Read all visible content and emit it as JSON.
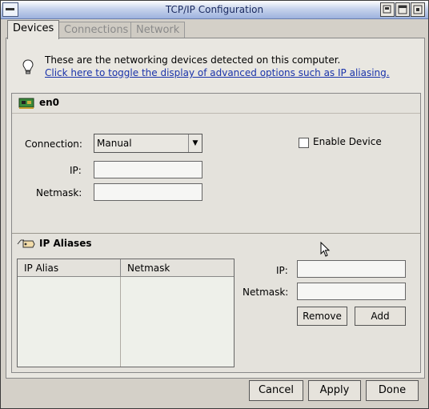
{
  "window": {
    "title": "TCP/IP Configuration",
    "tabs": [
      {
        "label": "Devices"
      },
      {
        "label": "Connections"
      },
      {
        "label": "Network"
      }
    ]
  },
  "info": {
    "text": "These are the networking devices detected on this computer.",
    "link": "Click here to toggle the display of advanced options such as IP aliasing."
  },
  "device": {
    "name": "en0",
    "connection_label": "Connection:",
    "connection_value": "Manual",
    "ip_label": "IP:",
    "ip_value": "",
    "netmask_label": "Netmask:",
    "netmask_value": "",
    "enable_label": "Enable Device",
    "enabled": false
  },
  "aliases": {
    "header": "IP Aliases",
    "columns": [
      "IP Alias",
      "Netmask"
    ],
    "rows": [],
    "ip_label": "IP:",
    "ip_value": "",
    "netmask_label": "Netmask:",
    "netmask_value": "",
    "remove_label": "Remove",
    "add_label": "Add"
  },
  "footer": {
    "cancel_label": "Cancel",
    "apply_label": "Apply",
    "done_label": "Done"
  }
}
